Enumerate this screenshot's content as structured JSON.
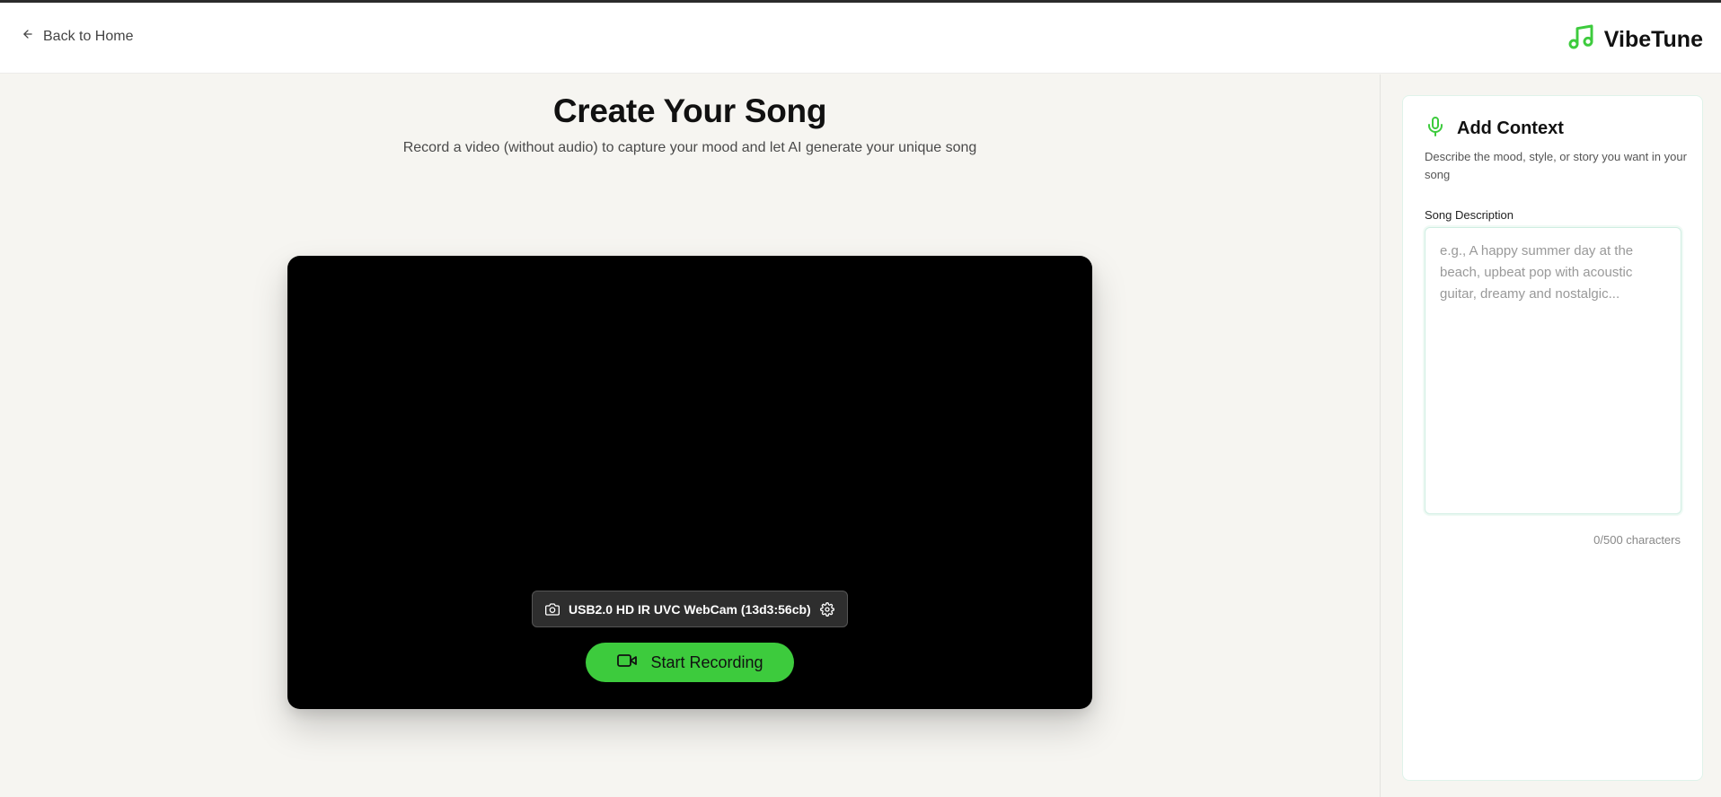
{
  "header": {
    "back_label": "Back to Home",
    "brand_name": "VibeTune"
  },
  "main": {
    "title": "Create Your Song",
    "subtitle": "Record a video (without audio) to capture your mood and let AI generate your unique song",
    "camera": {
      "device_name": "USB2.0 HD IR UVC WebCam (13d3:56cb)"
    },
    "record_button_label": "Start Recording"
  },
  "sidebar": {
    "title": "Add Context",
    "description": "Describe the mood, style, or story you want in your song",
    "field_label": "Song Description",
    "textarea_value": "",
    "textarea_placeholder": "e.g., A happy summer day at the beach, upbeat pop with acoustic guitar, dreamy and nostalgic...",
    "char_count": "0/500 characters"
  },
  "colors": {
    "accent": "#3dcb3d",
    "page_background": "#f6f5f1",
    "video_background": "#000000"
  },
  "icons": {
    "back": "arrow-left-icon",
    "brand": "music-note-icon",
    "camera": "camera-icon",
    "settings": "gear-icon",
    "record": "video-camera-icon",
    "context": "microphone-icon"
  }
}
